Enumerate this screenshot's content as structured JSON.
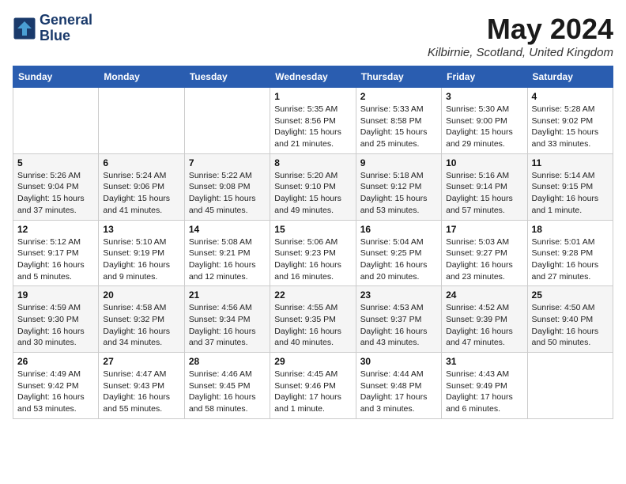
{
  "header": {
    "logo_line1": "General",
    "logo_line2": "Blue",
    "month_title": "May 2024",
    "location": "Kilbirnie, Scotland, United Kingdom"
  },
  "weekdays": [
    "Sunday",
    "Monday",
    "Tuesday",
    "Wednesday",
    "Thursday",
    "Friday",
    "Saturday"
  ],
  "weeks": [
    [
      {
        "day": "",
        "info": ""
      },
      {
        "day": "",
        "info": ""
      },
      {
        "day": "",
        "info": ""
      },
      {
        "day": "1",
        "info": "Sunrise: 5:35 AM\nSunset: 8:56 PM\nDaylight: 15 hours\nand 21 minutes."
      },
      {
        "day": "2",
        "info": "Sunrise: 5:33 AM\nSunset: 8:58 PM\nDaylight: 15 hours\nand 25 minutes."
      },
      {
        "day": "3",
        "info": "Sunrise: 5:30 AM\nSunset: 9:00 PM\nDaylight: 15 hours\nand 29 minutes."
      },
      {
        "day": "4",
        "info": "Sunrise: 5:28 AM\nSunset: 9:02 PM\nDaylight: 15 hours\nand 33 minutes."
      }
    ],
    [
      {
        "day": "5",
        "info": "Sunrise: 5:26 AM\nSunset: 9:04 PM\nDaylight: 15 hours\nand 37 minutes."
      },
      {
        "day": "6",
        "info": "Sunrise: 5:24 AM\nSunset: 9:06 PM\nDaylight: 15 hours\nand 41 minutes."
      },
      {
        "day": "7",
        "info": "Sunrise: 5:22 AM\nSunset: 9:08 PM\nDaylight: 15 hours\nand 45 minutes."
      },
      {
        "day": "8",
        "info": "Sunrise: 5:20 AM\nSunset: 9:10 PM\nDaylight: 15 hours\nand 49 minutes."
      },
      {
        "day": "9",
        "info": "Sunrise: 5:18 AM\nSunset: 9:12 PM\nDaylight: 15 hours\nand 53 minutes."
      },
      {
        "day": "10",
        "info": "Sunrise: 5:16 AM\nSunset: 9:14 PM\nDaylight: 15 hours\nand 57 minutes."
      },
      {
        "day": "11",
        "info": "Sunrise: 5:14 AM\nSunset: 9:15 PM\nDaylight: 16 hours\nand 1 minute."
      }
    ],
    [
      {
        "day": "12",
        "info": "Sunrise: 5:12 AM\nSunset: 9:17 PM\nDaylight: 16 hours\nand 5 minutes."
      },
      {
        "day": "13",
        "info": "Sunrise: 5:10 AM\nSunset: 9:19 PM\nDaylight: 16 hours\nand 9 minutes."
      },
      {
        "day": "14",
        "info": "Sunrise: 5:08 AM\nSunset: 9:21 PM\nDaylight: 16 hours\nand 12 minutes."
      },
      {
        "day": "15",
        "info": "Sunrise: 5:06 AM\nSunset: 9:23 PM\nDaylight: 16 hours\nand 16 minutes."
      },
      {
        "day": "16",
        "info": "Sunrise: 5:04 AM\nSunset: 9:25 PM\nDaylight: 16 hours\nand 20 minutes."
      },
      {
        "day": "17",
        "info": "Sunrise: 5:03 AM\nSunset: 9:27 PM\nDaylight: 16 hours\nand 23 minutes."
      },
      {
        "day": "18",
        "info": "Sunrise: 5:01 AM\nSunset: 9:28 PM\nDaylight: 16 hours\nand 27 minutes."
      }
    ],
    [
      {
        "day": "19",
        "info": "Sunrise: 4:59 AM\nSunset: 9:30 PM\nDaylight: 16 hours\nand 30 minutes."
      },
      {
        "day": "20",
        "info": "Sunrise: 4:58 AM\nSunset: 9:32 PM\nDaylight: 16 hours\nand 34 minutes."
      },
      {
        "day": "21",
        "info": "Sunrise: 4:56 AM\nSunset: 9:34 PM\nDaylight: 16 hours\nand 37 minutes."
      },
      {
        "day": "22",
        "info": "Sunrise: 4:55 AM\nSunset: 9:35 PM\nDaylight: 16 hours\nand 40 minutes."
      },
      {
        "day": "23",
        "info": "Sunrise: 4:53 AM\nSunset: 9:37 PM\nDaylight: 16 hours\nand 43 minutes."
      },
      {
        "day": "24",
        "info": "Sunrise: 4:52 AM\nSunset: 9:39 PM\nDaylight: 16 hours\nand 47 minutes."
      },
      {
        "day": "25",
        "info": "Sunrise: 4:50 AM\nSunset: 9:40 PM\nDaylight: 16 hours\nand 50 minutes."
      }
    ],
    [
      {
        "day": "26",
        "info": "Sunrise: 4:49 AM\nSunset: 9:42 PM\nDaylight: 16 hours\nand 53 minutes."
      },
      {
        "day": "27",
        "info": "Sunrise: 4:47 AM\nSunset: 9:43 PM\nDaylight: 16 hours\nand 55 minutes."
      },
      {
        "day": "28",
        "info": "Sunrise: 4:46 AM\nSunset: 9:45 PM\nDaylight: 16 hours\nand 58 minutes."
      },
      {
        "day": "29",
        "info": "Sunrise: 4:45 AM\nSunset: 9:46 PM\nDaylight: 17 hours\nand 1 minute."
      },
      {
        "day": "30",
        "info": "Sunrise: 4:44 AM\nSunset: 9:48 PM\nDaylight: 17 hours\nand 3 minutes."
      },
      {
        "day": "31",
        "info": "Sunrise: 4:43 AM\nSunset: 9:49 PM\nDaylight: 17 hours\nand 6 minutes."
      },
      {
        "day": "",
        "info": ""
      }
    ]
  ]
}
